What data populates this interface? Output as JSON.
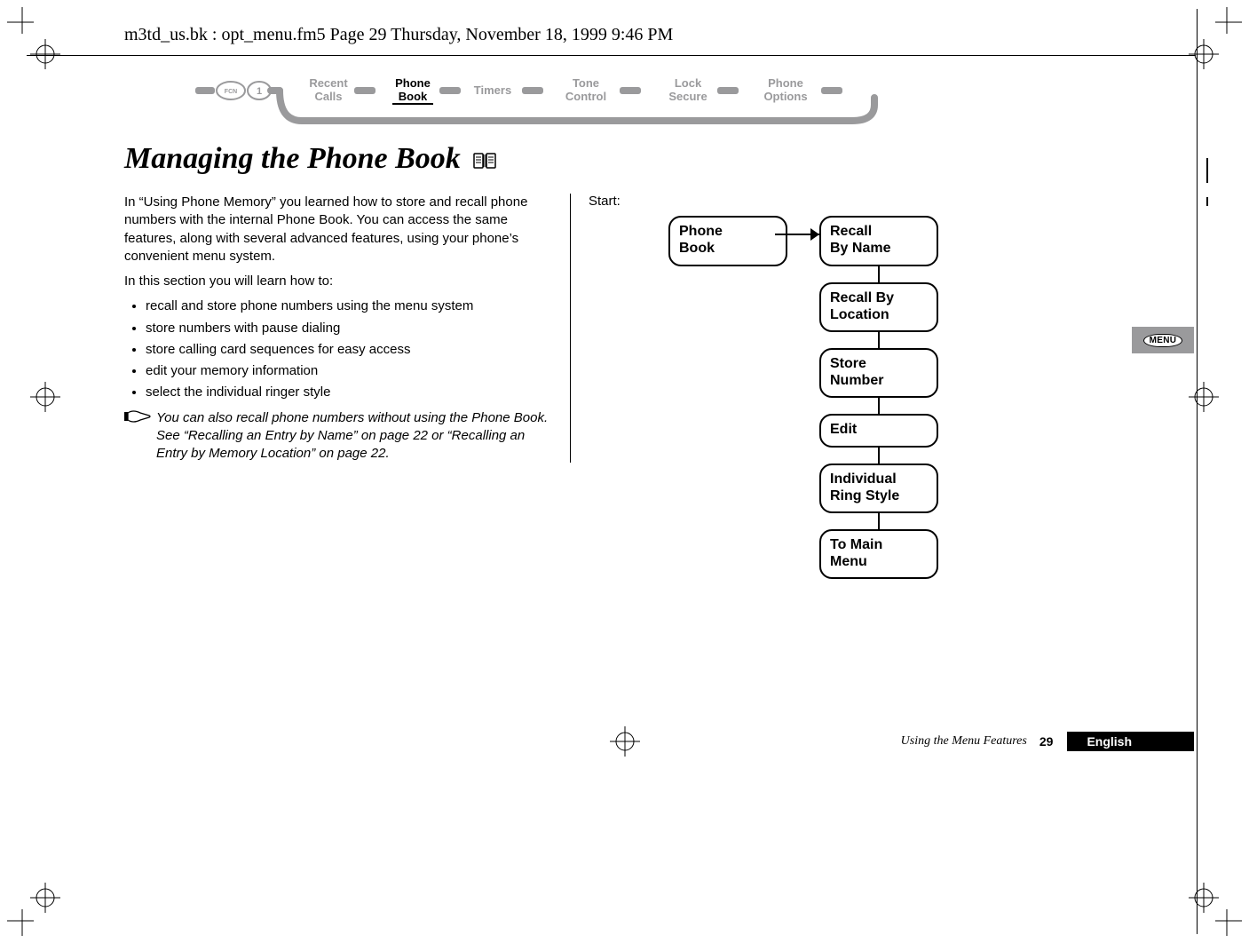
{
  "running_header": "m3td_us.bk : opt_menu.fm5  Page 29  Thursday, November 18, 1999  9:46 PM",
  "ribbon": {
    "items": [
      {
        "label": "Recent Calls",
        "active": false
      },
      {
        "label": "Phone Book",
        "active": true
      },
      {
        "label": "Timers",
        "active": false
      },
      {
        "label": "Tone Control",
        "active": false
      },
      {
        "label": "Lock Secure",
        "active": false
      },
      {
        "label": "Phone Options",
        "active": false
      }
    ],
    "fcn_label": "FCN",
    "one_label": "1"
  },
  "title": "Managing the Phone Book",
  "body": {
    "para1": "In “Using Phone Memory”  you learned how to store and recall phone numbers with the internal Phone Book. You can access the same features, along with several advanced features, using your phone’s convenient menu system.",
    "para2": "In this section you will learn how to:",
    "bullets": [
      "recall and store phone numbers using the menu system",
      "store numbers with pause dialing",
      "store calling card sequences for easy access",
      "edit your memory information",
      "select the individual ringer style"
    ],
    "note": "You can also recall phone numbers without using the Phone Book. See “Recalling an Entry by Name” on page 22 or “Recalling an Entry by Memory Location” on page 22."
  },
  "start_label": "Start:",
  "flow": {
    "entry": "Phone Book",
    "steps": [
      "Recall By Name",
      "Recall By Location",
      "Store Number",
      "Edit",
      "Individual Ring Style",
      "To Main Menu"
    ]
  },
  "menu_tab": "MENU",
  "footer": {
    "section": "Using the Menu Features",
    "page": "29",
    "language": "English"
  }
}
